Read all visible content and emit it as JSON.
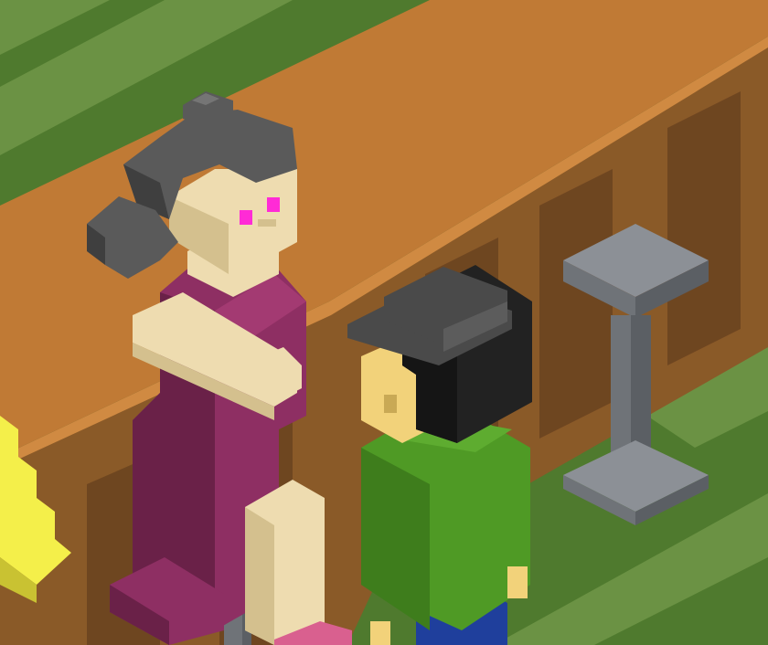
{
  "scene": {
    "style": "isometric voxel",
    "palette": {
      "floor_light": "#6b9244",
      "floor_dark": "#4f7a2e",
      "bar_top": "#c07a35",
      "bar_front": "#8a5a28",
      "bar_panel_dark": "#6e4620",
      "npc_dress": "#8e2f63",
      "npc_dress_shadow": "#6a2148",
      "npc_hair": "#5a5a5a",
      "npc_skin": "#eedcb0",
      "npc_eyes": "#ff2bd6",
      "player_hair": "#222222",
      "player_hat": "#4a4a4a",
      "player_shirt": "#4f9a25",
      "player_pants": "#1f3f9c",
      "player_skin": "#f2d27a",
      "stool_metal": "#8c9096",
      "yellow_figure": "#f4ef4a"
    },
    "objects": [
      {
        "name": "bar-counter",
        "kind": "counter"
      },
      {
        "name": "npc-woman",
        "kind": "character",
        "eyes": "glowing magenta"
      },
      {
        "name": "player-character",
        "kind": "character"
      },
      {
        "name": "bar-stool",
        "kind": "furniture"
      },
      {
        "name": "yellow-figure",
        "kind": "character-partial"
      },
      {
        "name": "gray-post",
        "kind": "prop"
      }
    ]
  }
}
